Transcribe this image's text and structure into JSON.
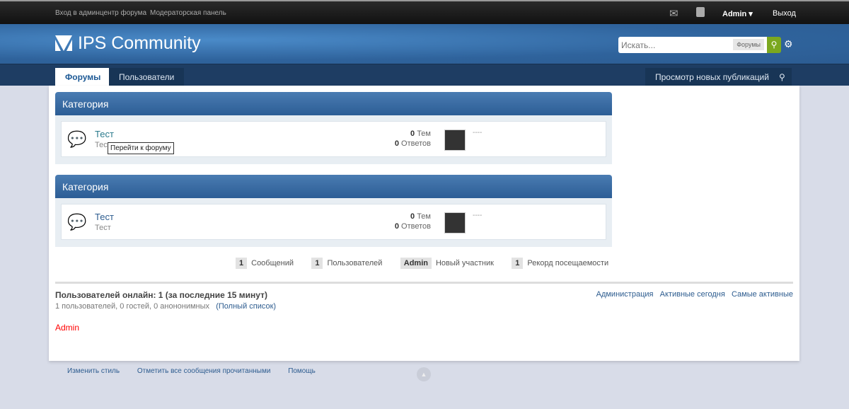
{
  "topbar": {
    "admin_cp": "Вход в админцентр форума",
    "mod_panel": "Модераторская панель",
    "user": "Admin",
    "logout": "Выход",
    "icons": [
      "envelope-icon",
      "user-card-icon"
    ]
  },
  "header": {
    "logo": "IPS Community",
    "search_placeholder": "Искать...",
    "search_scope": "Форумы"
  },
  "nav": {
    "tabs": [
      "Форумы",
      "Пользователи"
    ],
    "new_content": "Просмотр новых публикаций"
  },
  "categories": [
    {
      "title": "Категория",
      "forum": {
        "name": "Тест",
        "desc": "Тест",
        "topics": "0",
        "topics_label": "Тем",
        "replies": "0",
        "replies_label": "Ответов",
        "last": "----"
      }
    },
    {
      "title": "Категория",
      "forum": {
        "name": "Тест",
        "desc": "Тест",
        "topics": "0",
        "topics_label": "Тем",
        "replies": "0",
        "replies_label": "Ответов",
        "last": "----"
      }
    }
  ],
  "tooltip": "Перейти к форуму",
  "stats": [
    {
      "v": "1",
      "l": "Сообщений"
    },
    {
      "v": "1",
      "l": "Пользователей"
    },
    {
      "v": "Admin",
      "l": "Новый участник"
    },
    {
      "v": "1",
      "l": "Рекорд посещаемости"
    }
  ],
  "online": {
    "title": "Пользователей онлайн: 1 (за последние 15 минут)",
    "sub": "1 пользователей, 0 гостей, 0 анононимных",
    "full_list": "(Полный список)",
    "links": [
      "Администрация",
      "Активные сегодня",
      "Самые активные"
    ],
    "user": "Admin",
    "user_color": "#ff0000"
  },
  "footer": [
    "Изменить стиль",
    "Отметить все сообщения прочитанными",
    "Помощь"
  ]
}
